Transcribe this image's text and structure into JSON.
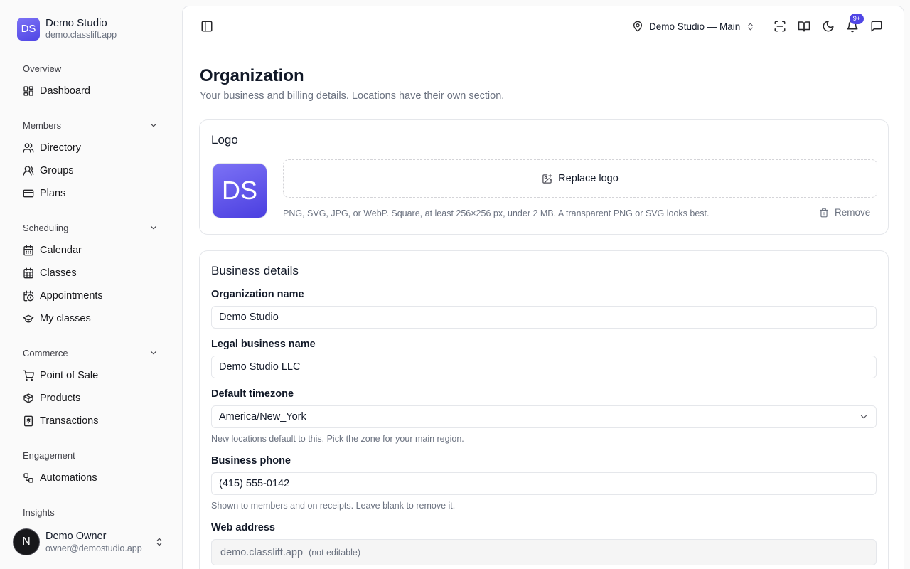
{
  "brand": {
    "initials": "DS",
    "name": "Demo Studio",
    "domain": "demo.classlift.app"
  },
  "sidebar": {
    "overview": {
      "label": "Overview",
      "items": [
        {
          "label": "Dashboard",
          "icon": "dashboard-icon"
        }
      ]
    },
    "members": {
      "label": "Members",
      "items": [
        {
          "label": "Directory",
          "icon": "users-icon"
        },
        {
          "label": "Groups",
          "icon": "user-group-icon"
        },
        {
          "label": "Plans",
          "icon": "credit-card-icon"
        }
      ]
    },
    "scheduling": {
      "label": "Scheduling",
      "items": [
        {
          "label": "Calendar",
          "icon": "calendar-icon"
        },
        {
          "label": "Classes",
          "icon": "calendar-grid-icon"
        },
        {
          "label": "Appointments",
          "icon": "calendar-clock-icon"
        },
        {
          "label": "My classes",
          "icon": "graduation-cap-icon"
        }
      ]
    },
    "commerce": {
      "label": "Commerce",
      "items": [
        {
          "label": "Point of Sale",
          "icon": "cart-icon"
        },
        {
          "label": "Products",
          "icon": "package-icon"
        },
        {
          "label": "Transactions",
          "icon": "receipt-dollar-icon"
        }
      ]
    },
    "engagement": {
      "label": "Engagement",
      "items": [
        {
          "label": "Automations",
          "icon": "workflow-icon"
        }
      ]
    },
    "insights": {
      "label": "Insights"
    }
  },
  "user": {
    "initial": "N",
    "name": "Demo Owner",
    "email": "owner@demostudio.app"
  },
  "topbar": {
    "location": "Demo Studio — Main",
    "notifications_badge": "9+"
  },
  "page": {
    "title": "Organization",
    "subtitle": "Your business and billing details. Locations have their own section."
  },
  "logo_card": {
    "title": "Logo",
    "preview_initials": "DS",
    "replace_label": "Replace logo",
    "help": "PNG, SVG, JPG, or WebP. Square, at least 256×256 px, under 2 MB. A transparent PNG or SVG looks best.",
    "remove_label": "Remove"
  },
  "business": {
    "title": "Business details",
    "org_name": {
      "label": "Organization name",
      "value": "Demo Studio"
    },
    "legal_name": {
      "label": "Legal business name",
      "value": "Demo Studio LLC"
    },
    "timezone": {
      "label": "Default timezone",
      "value": "America/New_York",
      "help": "New locations default to this. Pick the zone for your main region."
    },
    "phone": {
      "label": "Business phone",
      "value": "(415) 555-0142",
      "help": "Shown to members and on receipts. Leave blank to remove it."
    },
    "web": {
      "label": "Web address",
      "value": "demo.classlift.app",
      "note": "(not editable)"
    }
  },
  "colors": {
    "accent": "#5046e5",
    "border": "#e5e7eb",
    "muted_text": "#6b7280"
  }
}
